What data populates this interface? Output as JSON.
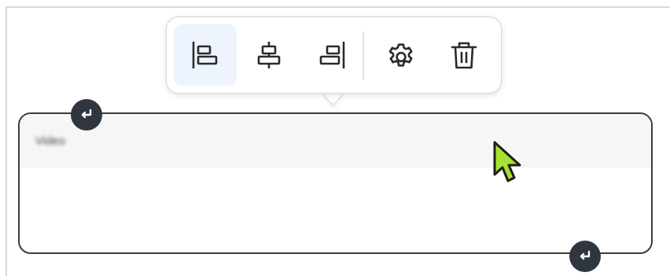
{
  "block": {
    "title": "Video"
  },
  "toolbar": {
    "buttons": [
      {
        "name": "align-left",
        "icon": "align-left-icon",
        "active": true
      },
      {
        "name": "align-center",
        "icon": "align-center-icon",
        "active": false
      },
      {
        "name": "align-right",
        "icon": "align-right-icon",
        "active": false
      },
      {
        "name": "settings",
        "icon": "gear-icon",
        "active": false
      },
      {
        "name": "delete",
        "icon": "trash-icon",
        "active": false
      }
    ]
  },
  "handles": {
    "top": "insert-before-icon",
    "bottom": "insert-after-icon"
  },
  "colors": {
    "active_bg": "#eef4fd",
    "icon": "#2b2b2b",
    "border": "#3b3b3b",
    "handle": "#2f3640",
    "cursor": "#a6e22e"
  }
}
